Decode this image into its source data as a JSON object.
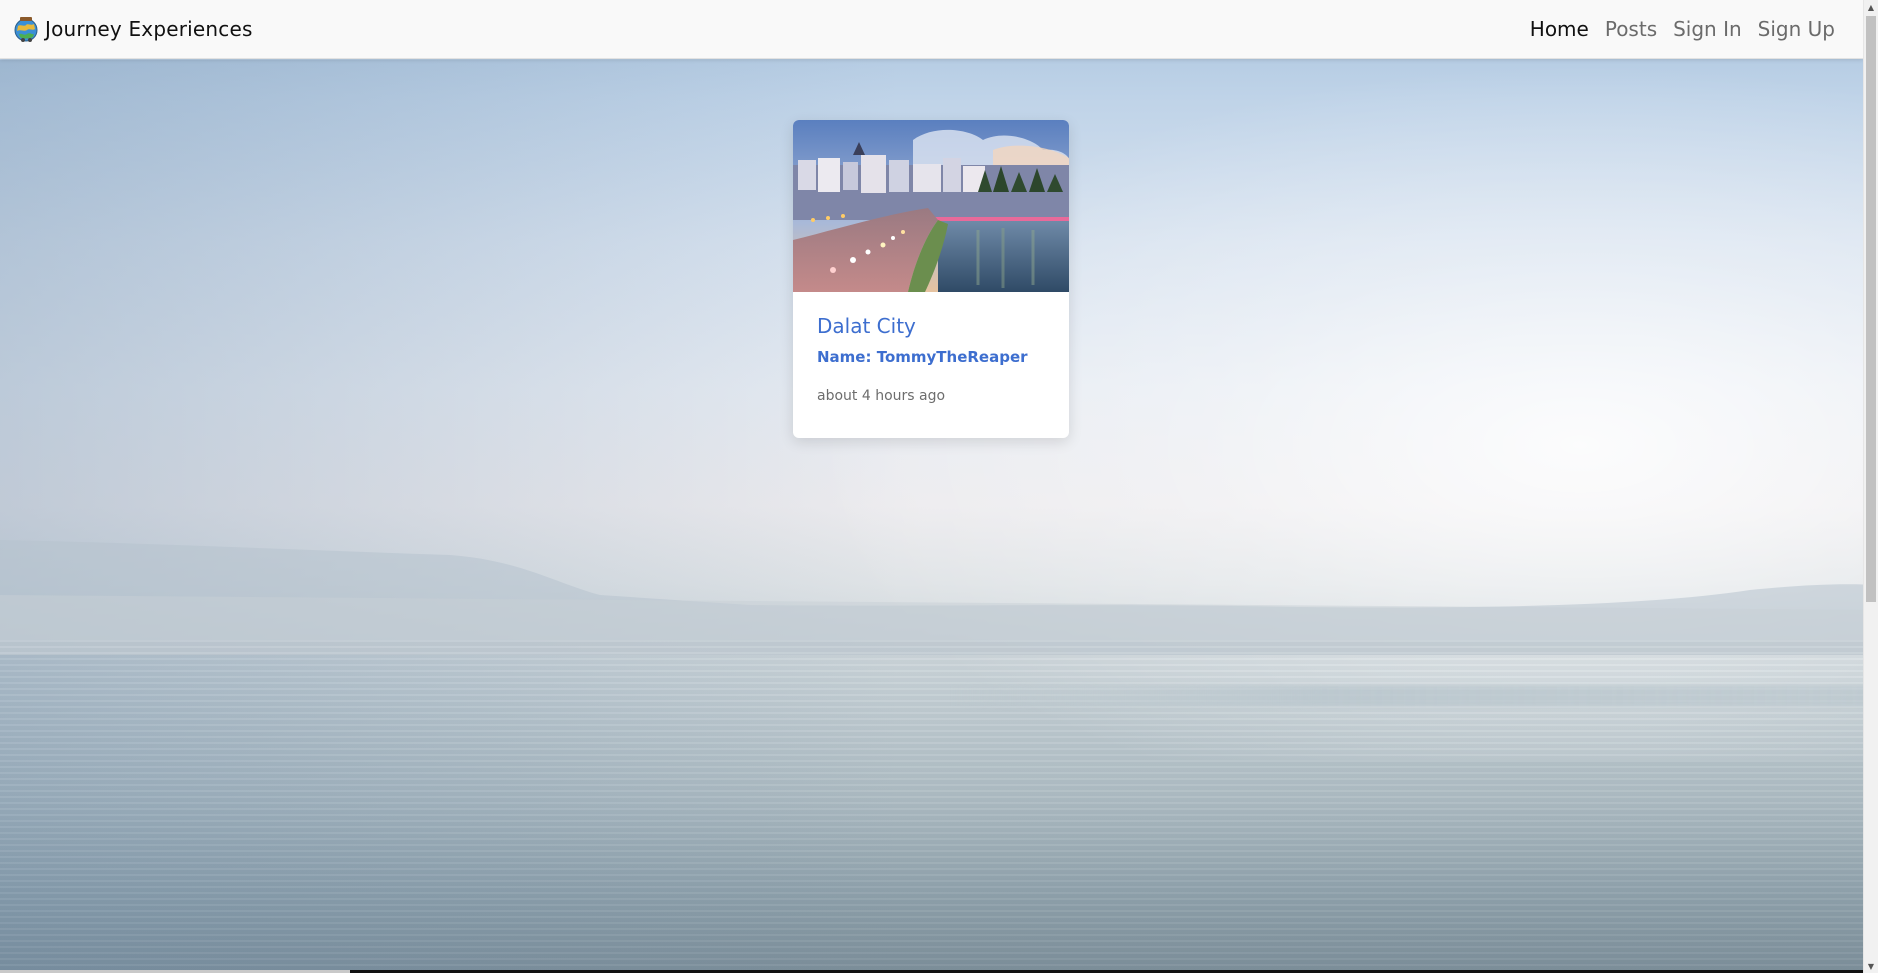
{
  "navbar": {
    "brand": "Journey Experiences",
    "links": [
      {
        "label": "Home",
        "active": true
      },
      {
        "label": "Posts",
        "active": false
      },
      {
        "label": "Sign In",
        "active": false
      },
      {
        "label": "Sign Up",
        "active": false
      }
    ]
  },
  "posts": [
    {
      "title": "Dalat City",
      "author": "Name: TommyTheReaper",
      "time": "about 4 hours ago"
    }
  ],
  "colors": {
    "link_blue": "#3d6ecf",
    "nav_active": "#111111",
    "nav_inactive": "#6b6b6b"
  }
}
